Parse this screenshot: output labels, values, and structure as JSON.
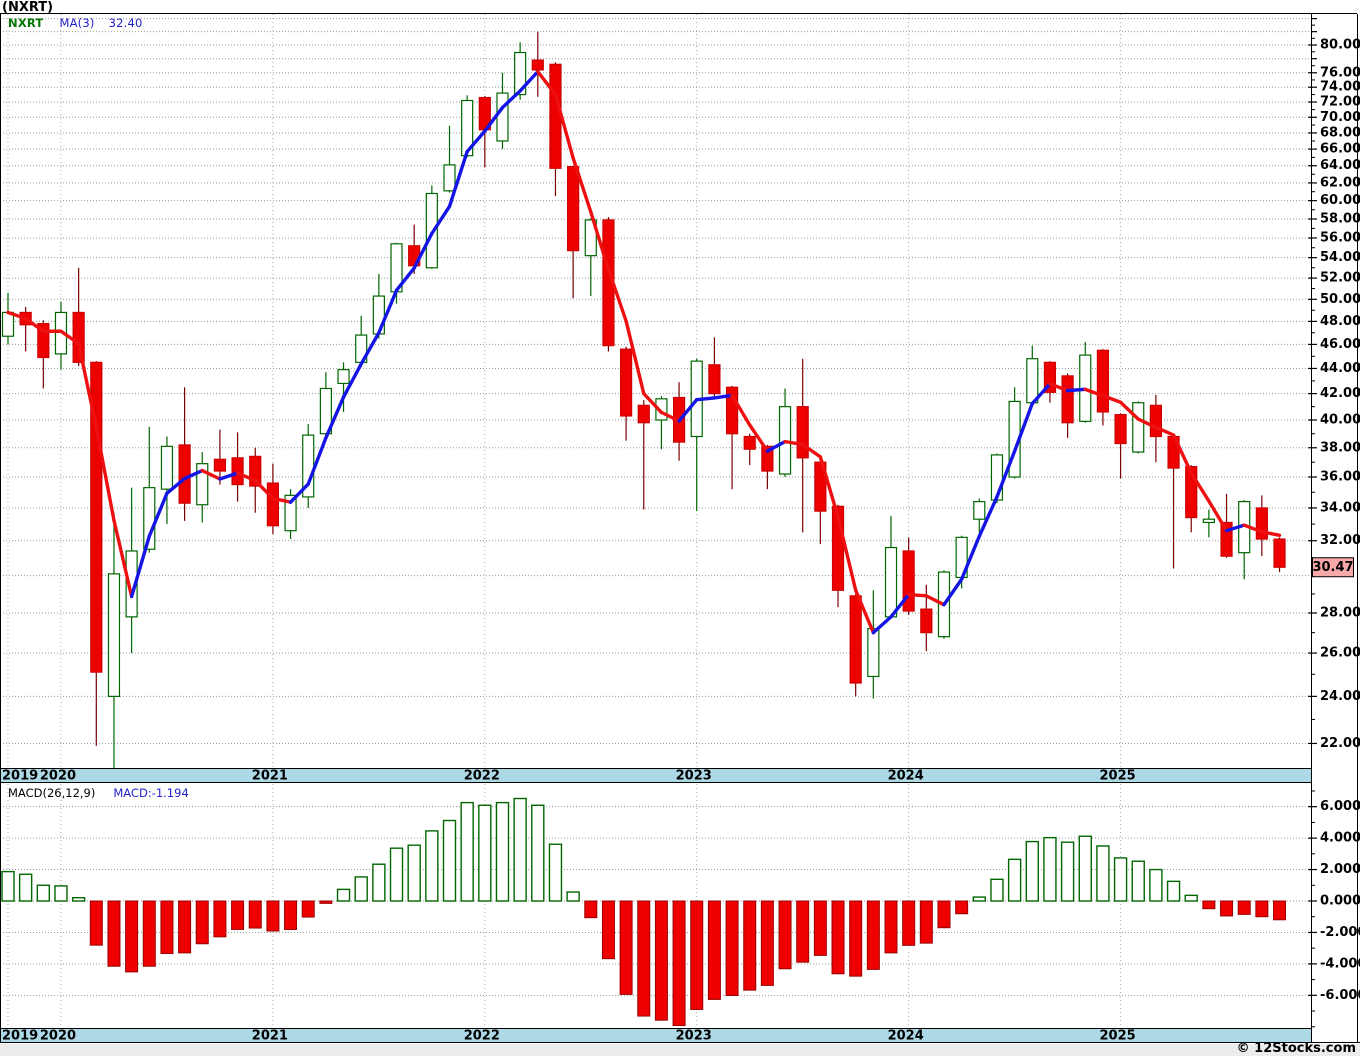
{
  "window": {
    "title": "(NXRT)"
  },
  "main_legend": {
    "ticker": "NXRT",
    "ma_label": "MA(3)",
    "ma_value": "32.40"
  },
  "macd_legend": {
    "indicator": "MACD(26,12,9)",
    "current": "MACD:-1.194"
  },
  "price_badge": "30.47",
  "copyright": "© 12Stocks.com",
  "colors": {
    "up_outline": "#006600",
    "up_wick": "#006600",
    "up_fill": "#ffffff",
    "down_fill": "#ee0000",
    "down_border": "#cc0000",
    "down_wick": "#7a0000",
    "ma_up": "#1414e6",
    "ma_down": "#ee1010",
    "grid": "#9a9a9a",
    "vgrid": "#aaaaaa",
    "axis": "#000000",
    "strip_bg": "#add8e6",
    "badge_bg": "#f7a8a8",
    "badge_border": "#000000",
    "macd_pos_outline": "#006600",
    "macd_neg_fill": "#ee0000",
    "macd_neg_border": "#990000"
  },
  "chart_data": {
    "type": "candlestick",
    "symbol": "NXRT",
    "interval": "monthly",
    "start_month": "2019-10",
    "end_month": "2025-10",
    "price_axis": {
      "scale": "log",
      "labeled_ticks": [
        80,
        76,
        74,
        72,
        70,
        68,
        66,
        64,
        62,
        60,
        58,
        56,
        54,
        52,
        50,
        48,
        46,
        44,
        42,
        40,
        38,
        36,
        34,
        32,
        28,
        26,
        24,
        22
      ],
      "unlabeled_major_ticks": [
        84,
        82,
        78,
        30
      ],
      "minor_tick_step": 1,
      "last_price": 30.47
    },
    "year_ticks": [
      {
        "label": "2019",
        "candle_index": 0
      },
      {
        "label": "2020",
        "candle_index": 3
      },
      {
        "label": "2021",
        "candle_index": 15
      },
      {
        "label": "2022",
        "candle_index": 27
      },
      {
        "label": "2023",
        "candle_index": 39
      },
      {
        "label": "2024",
        "candle_index": 51
      },
      {
        "label": "2025",
        "candle_index": 63
      }
    ],
    "ma_period": 3,
    "ma_current": 32.4,
    "candles_ohlc": [
      [
        46.7,
        50.6,
        46.0,
        48.8
      ],
      [
        48.8,
        49.3,
        45.4,
        47.7
      ],
      [
        47.8,
        48.1,
        42.4,
        44.9
      ],
      [
        45.2,
        49.8,
        43.9,
        48.8
      ],
      [
        48.8,
        53.0,
        44.2,
        44.5
      ],
      [
        44.5,
        44.6,
        21.9,
        25.1
      ],
      [
        24.0,
        33.7,
        21.0,
        30.1
      ],
      [
        27.8,
        35.3,
        26.0,
        31.4
      ],
      [
        31.5,
        39.5,
        31.3,
        35.3
      ],
      [
        35.2,
        38.8,
        33.0,
        38.1
      ],
      [
        38.2,
        42.5,
        33.2,
        34.3
      ],
      [
        34.2,
        37.7,
        33.1,
        36.9
      ],
      [
        37.2,
        39.3,
        35.5,
        36.4
      ],
      [
        37.3,
        39.1,
        34.4,
        35.5
      ],
      [
        37.4,
        38.0,
        33.7,
        35.4
      ],
      [
        35.6,
        36.9,
        32.4,
        32.9
      ],
      [
        32.6,
        35.2,
        32.1,
        34.8
      ],
      [
        34.7,
        39.7,
        34.0,
        38.9
      ],
      [
        39.0,
        43.7,
        38.7,
        42.4
      ],
      [
        42.8,
        44.5,
        40.6,
        43.9
      ],
      [
        44.5,
        48.5,
        44.1,
        46.8
      ],
      [
        46.9,
        52.4,
        46.5,
        50.3
      ],
      [
        50.7,
        55.5,
        49.6,
        55.4
      ],
      [
        55.2,
        57.4,
        52.4,
        53.2
      ],
      [
        53.0,
        61.7,
        52.9,
        60.8
      ],
      [
        61.1,
        68.9,
        60.9,
        64.1
      ],
      [
        65.2,
        72.9,
        65.0,
        72.2
      ],
      [
        72.6,
        72.8,
        63.8,
        68.4
      ],
      [
        67.0,
        76.0,
        66.0,
        73.2
      ],
      [
        73.0,
        80.4,
        72.3,
        78.9
      ],
      [
        77.8,
        82.0,
        72.7,
        76.4
      ],
      [
        77.2,
        77.5,
        60.5,
        63.7
      ],
      [
        63.9,
        64.0,
        50.1,
        54.7
      ],
      [
        54.2,
        58.1,
        50.3,
        57.9
      ],
      [
        57.9,
        58.2,
        45.4,
        45.9
      ],
      [
        45.6,
        45.8,
        38.5,
        40.3
      ],
      [
        41.1,
        41.5,
        33.9,
        39.8
      ],
      [
        40.0,
        41.8,
        37.9,
        41.6
      ],
      [
        41.7,
        42.9,
        37.1,
        38.4
      ],
      [
        38.8,
        44.8,
        33.8,
        44.6
      ],
      [
        44.3,
        46.6,
        41.8,
        42.0
      ],
      [
        42.5,
        42.6,
        35.2,
        39.0
      ],
      [
        38.8,
        39.0,
        36.8,
        37.9
      ],
      [
        38.1,
        38.2,
        35.2,
        36.4
      ],
      [
        36.2,
        42.4,
        36.0,
        41.0
      ],
      [
        41.0,
        44.8,
        32.5,
        37.3
      ],
      [
        37.0,
        37.2,
        31.8,
        33.8
      ],
      [
        34.1,
        34.2,
        28.3,
        29.2
      ],
      [
        28.9,
        29.0,
        24.0,
        24.6
      ],
      [
        24.9,
        29.2,
        23.9,
        27.2
      ],
      [
        27.8,
        33.5,
        27.7,
        31.6
      ],
      [
        31.4,
        32.2,
        27.9,
        28.1
      ],
      [
        28.2,
        29.5,
        26.1,
        27.0
      ],
      [
        26.8,
        30.3,
        26.7,
        30.2
      ],
      [
        29.9,
        32.3,
        29.3,
        32.2
      ],
      [
        33.3,
        34.6,
        32.5,
        34.4
      ],
      [
        34.5,
        37.6,
        34.3,
        37.5
      ],
      [
        36.0,
        42.5,
        35.9,
        41.4
      ],
      [
        41.3,
        45.9,
        41.2,
        44.8
      ],
      [
        44.5,
        44.6,
        41.3,
        42.1
      ],
      [
        43.4,
        43.6,
        38.7,
        39.8
      ],
      [
        39.9,
        46.2,
        39.8,
        45.1
      ],
      [
        45.5,
        45.6,
        39.6,
        40.6
      ],
      [
        40.4,
        40.5,
        35.9,
        38.3
      ],
      [
        37.7,
        41.4,
        37.6,
        41.3
      ],
      [
        41.1,
        41.9,
        37.0,
        38.8
      ],
      [
        38.8,
        38.9,
        30.4,
        36.6
      ],
      [
        36.7,
        36.8,
        32.5,
        33.4
      ],
      [
        33.1,
        33.9,
        32.2,
        33.3
      ],
      [
        33.1,
        34.9,
        31.0,
        31.1
      ],
      [
        31.3,
        34.5,
        29.8,
        34.4
      ],
      [
        34.0,
        34.8,
        31.1,
        32.1
      ],
      [
        32.1,
        32.2,
        30.2,
        30.47
      ]
    ],
    "macd_axis": {
      "labeled_ticks": [
        6,
        4,
        2,
        0,
        -2,
        -4,
        -6
      ],
      "minor_tick_step": 1,
      "current": -1.194
    },
    "macd_values": [
      1.87,
      1.7,
      1.0,
      0.96,
      0.21,
      -2.81,
      -4.15,
      -4.51,
      -4.15,
      -3.34,
      -3.3,
      -2.72,
      -2.28,
      -1.81,
      -1.72,
      -1.91,
      -1.81,
      -1.02,
      -0.15,
      0.74,
      1.53,
      2.34,
      3.36,
      3.55,
      4.46,
      5.12,
      6.26,
      6.09,
      6.26,
      6.52,
      6.09,
      3.61,
      0.57,
      -1.06,
      -3.67,
      -5.94,
      -7.32,
      -7.58,
      -7.92,
      -6.9,
      -6.26,
      -6.01,
      -5.67,
      -5.37,
      -4.31,
      -3.89,
      -3.46,
      -4.63,
      -4.78,
      -4.35,
      -3.3,
      -2.82,
      -2.68,
      -1.7,
      -0.81,
      0.25,
      1.38,
      2.65,
      3.78,
      4.03,
      3.74,
      4.12,
      3.5,
      2.74,
      2.53,
      2.0,
      1.25,
      0.36,
      -0.49,
      -0.95,
      -0.85,
      -1.0,
      -1.194
    ]
  }
}
